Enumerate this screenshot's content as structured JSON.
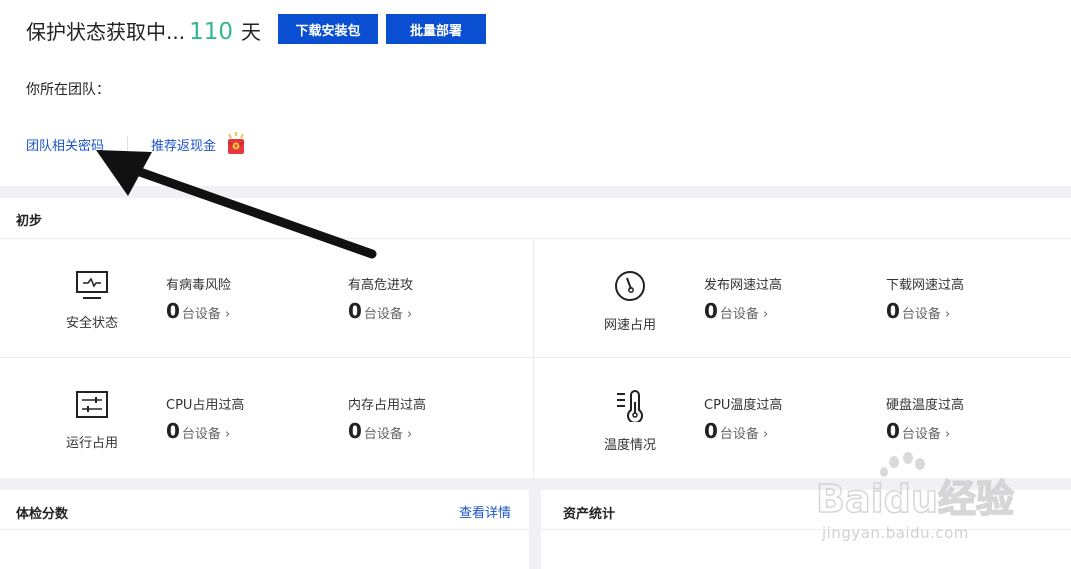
{
  "header": {
    "status_text": "保护状态获取中...",
    "days": "110",
    "days_unit": "天",
    "download_button": "下载安装包",
    "deploy_button": "批量部署",
    "team_label": "你所在团队："
  },
  "links": {
    "team_password": "团队相关密码",
    "referral_cashback": "推荐返现金"
  },
  "overview": {
    "title": "初步",
    "categories": [
      {
        "label": "安全状态",
        "icon": "monitor-icon",
        "metrics": [
          {
            "label": "有病毒风险",
            "count": "0",
            "unit": "台设备"
          },
          {
            "label": "有高危进攻",
            "count": "0",
            "unit": "台设备"
          }
        ]
      },
      {
        "label": "网速占用",
        "icon": "speedometer-icon",
        "metrics": [
          {
            "label": "发布网速过高",
            "count": "0",
            "unit": "台设备"
          },
          {
            "label": "下载网速过高",
            "count": "0",
            "unit": "台设备"
          }
        ]
      },
      {
        "label": "运行占用",
        "icon": "sliders-icon",
        "metrics": [
          {
            "label": "CPU占用过高",
            "count": "0",
            "unit": "台设备"
          },
          {
            "label": "内存占用过高",
            "count": "0",
            "unit": "台设备"
          }
        ]
      },
      {
        "label": "温度情况",
        "icon": "thermometer-icon",
        "metrics": [
          {
            "label": "CPU温度过高",
            "count": "0",
            "unit": "台设备"
          },
          {
            "label": "硬盘温度过高",
            "count": "0",
            "unit": "台设备"
          }
        ]
      }
    ]
  },
  "score_card": {
    "title": "体检分数",
    "detail_link": "查看详情"
  },
  "assets_card": {
    "title": "资产统计"
  },
  "watermark": {
    "brand": "Baidu经验",
    "url": "jingyan.baidu.com"
  },
  "colors": {
    "primary_button": "#0a4fd1",
    "link": "#1a55c9",
    "days_highlight": "#2fb98b",
    "page_gray": "#f0f0f5"
  }
}
